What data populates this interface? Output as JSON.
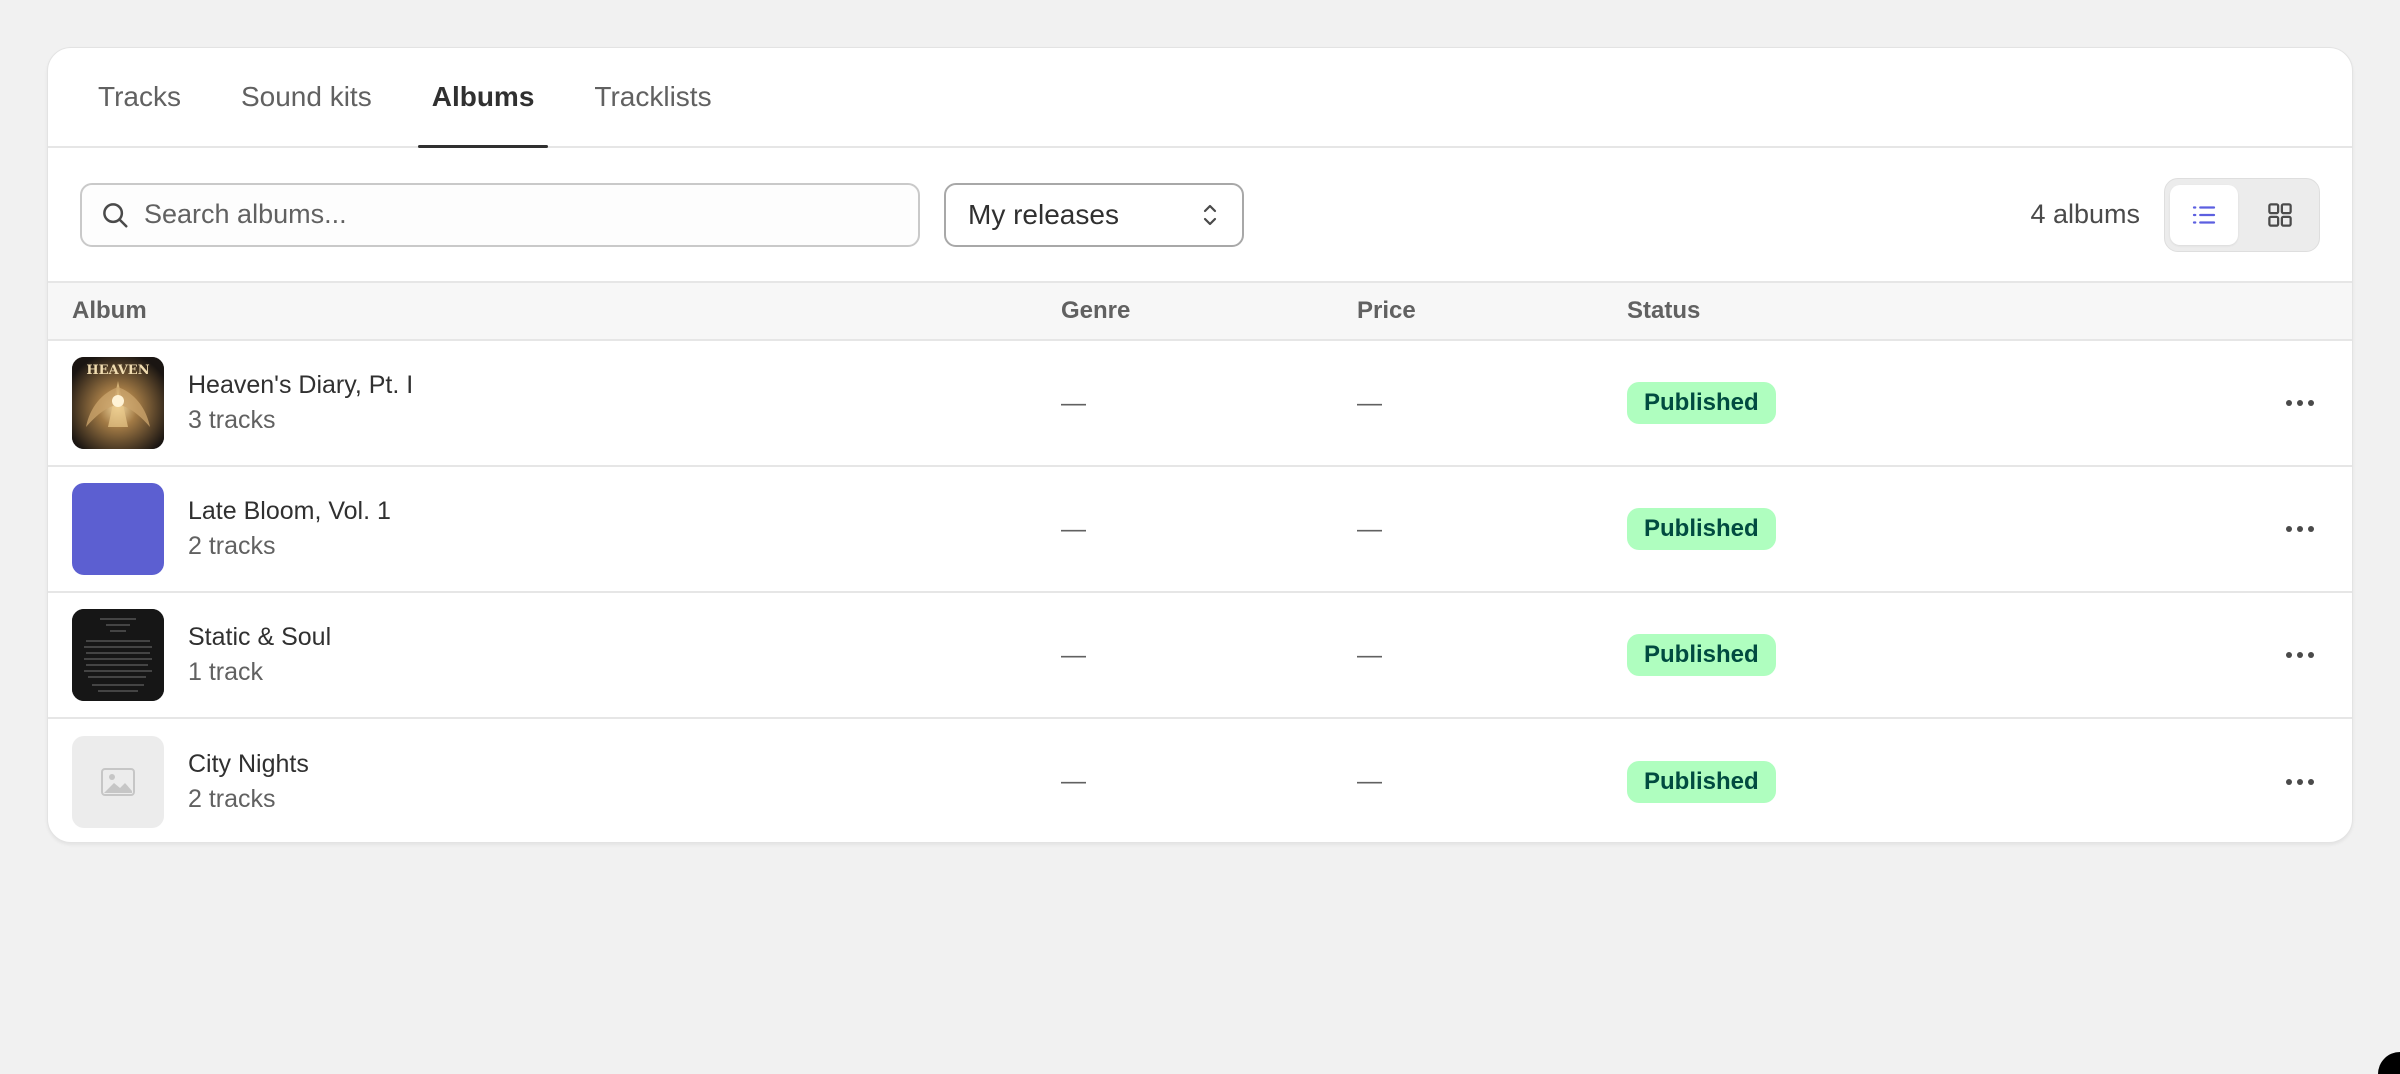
{
  "tabs": [
    {
      "label": "Tracks",
      "active": false
    },
    {
      "label": "Sound kits",
      "active": false
    },
    {
      "label": "Albums",
      "active": true
    },
    {
      "label": "Tracklists",
      "active": false
    }
  ],
  "search": {
    "placeholder": "Search albums...",
    "value": "",
    "icon": "search-icon"
  },
  "filter": {
    "selected": "My releases",
    "icon": "select-chevrons-icon"
  },
  "album_count": "4 albums",
  "view_toggle": {
    "active": "list",
    "options": [
      "list-view-icon",
      "grid-view-icon"
    ]
  },
  "colors": {
    "accent": "#5c5fe0",
    "badge_bg": "#affebf",
    "badge_text": "#014b40"
  },
  "table": {
    "columns": [
      "Album",
      "Genre",
      "Price",
      "Status"
    ],
    "rows": [
      {
        "name": "Heaven's Diary, Pt. I",
        "tracks": "3 tracks",
        "genre": "—",
        "price": "—",
        "status": "Published",
        "cover": "artwork-cover"
      },
      {
        "name": "Late Bloom, Vol. 1",
        "tracks": "2 tracks",
        "genre": "—",
        "price": "—",
        "status": "Published",
        "cover": "solid-color-cover",
        "cover_color": "#5c5fd1"
      },
      {
        "name": "Static & Soul",
        "tracks": "1 track",
        "genre": "—",
        "price": "—",
        "status": "Published",
        "cover": "dark-text-cover"
      },
      {
        "name": "City Nights",
        "tracks": "2 tracks",
        "genre": "—",
        "price": "—",
        "status": "Published",
        "cover": "image-placeholder-icon"
      }
    ]
  }
}
